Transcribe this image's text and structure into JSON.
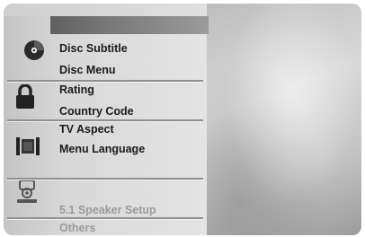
{
  "menu": {
    "groups": [
      {
        "icon": "disc-icon",
        "items": [
          {
            "label": "Disc Subtitle"
          },
          {
            "label": "Disc Menu"
          }
        ]
      },
      {
        "icon": "padlock-icon",
        "items": [
          {
            "label": "Rating"
          },
          {
            "label": "Country Code"
          }
        ]
      },
      {
        "icon": "tv-screen-icon",
        "items": [
          {
            "label": "TV Aspect"
          },
          {
            "label": "Menu Language"
          }
        ]
      },
      {
        "icon": "speaker-icon",
        "items": [
          {
            "label": "5.1 Speaker Setup",
            "state": "dimmed"
          },
          {
            "label": "Others",
            "state": "dimmed"
          }
        ]
      }
    ]
  },
  "colors": {
    "text": "#1a1a1a",
    "dimmed_text": "#9a9a9a",
    "header_bar": "#6e6e6e"
  }
}
